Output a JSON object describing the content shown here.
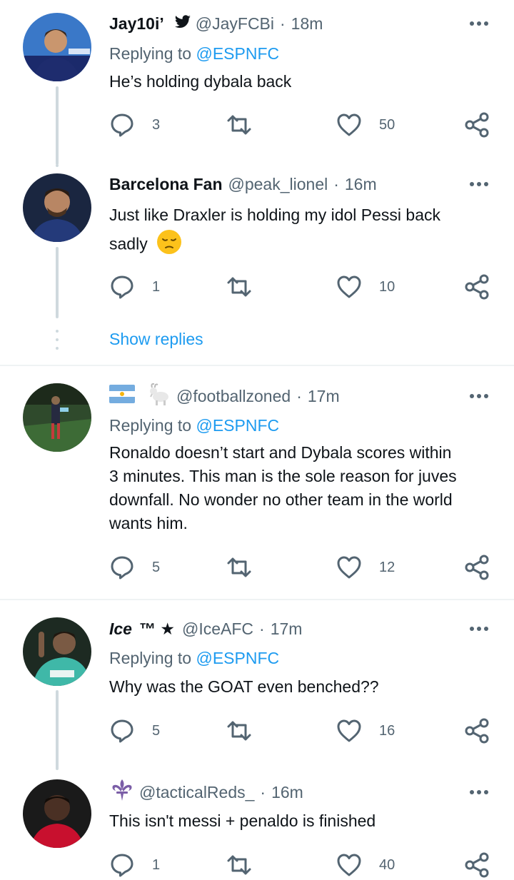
{
  "tweets": [
    {
      "name": "Jay10i’",
      "handle": "@JayFCBi",
      "time": "18m",
      "replying_label": "Replying to",
      "replying_to": "@ESPNFC",
      "text": "He’s holding dybala back",
      "replies": "3",
      "likes": "50",
      "name_icon": "twitter-bird-icon"
    },
    {
      "name": "Barcelona Fan",
      "handle": "@peak_lionel",
      "time": "16m",
      "text": "Just like Draxler is holding my idol Pessi back",
      "text_line2": "sadly",
      "emoji": "pensive-face-emoji",
      "replies": "1",
      "likes": "10"
    },
    {
      "handle": "@footballzoned",
      "time": "17m",
      "name_icons": [
        "argentina-flag-icon",
        "goat-icon"
      ],
      "replying_label": "Replying to",
      "replying_to": "@ESPNFC",
      "text_lines": [
        "Ronaldo doesn’t start and Dybala scores within",
        "3 minutes. This man is the sole reason for juves",
        "downfall. No wonder no other team in the world",
        "wants him."
      ],
      "replies": "5",
      "likes": "12"
    },
    {
      "name": "Ice",
      "name_suffix": "™ ★",
      "handle": "@IceAFC",
      "time": "17m",
      "replying_label": "Replying to",
      "replying_to": "@ESPNFC",
      "text": "Why was the GOAT even benched??",
      "replies": "5",
      "likes": "16"
    },
    {
      "handle": "@tacticalReds_",
      "time": "16m",
      "name_icon": "fleur-de-lis-icon",
      "text": "This isn't messi + penaldo is finished",
      "replies": "1",
      "likes": "40"
    }
  ],
  "show_replies": "Show replies",
  "dot_separator": "·",
  "colors": {
    "link": "#1d9bf0",
    "secondary": "#536471",
    "thread_line": "#cfd9de",
    "divider": "#eff3f4"
  }
}
